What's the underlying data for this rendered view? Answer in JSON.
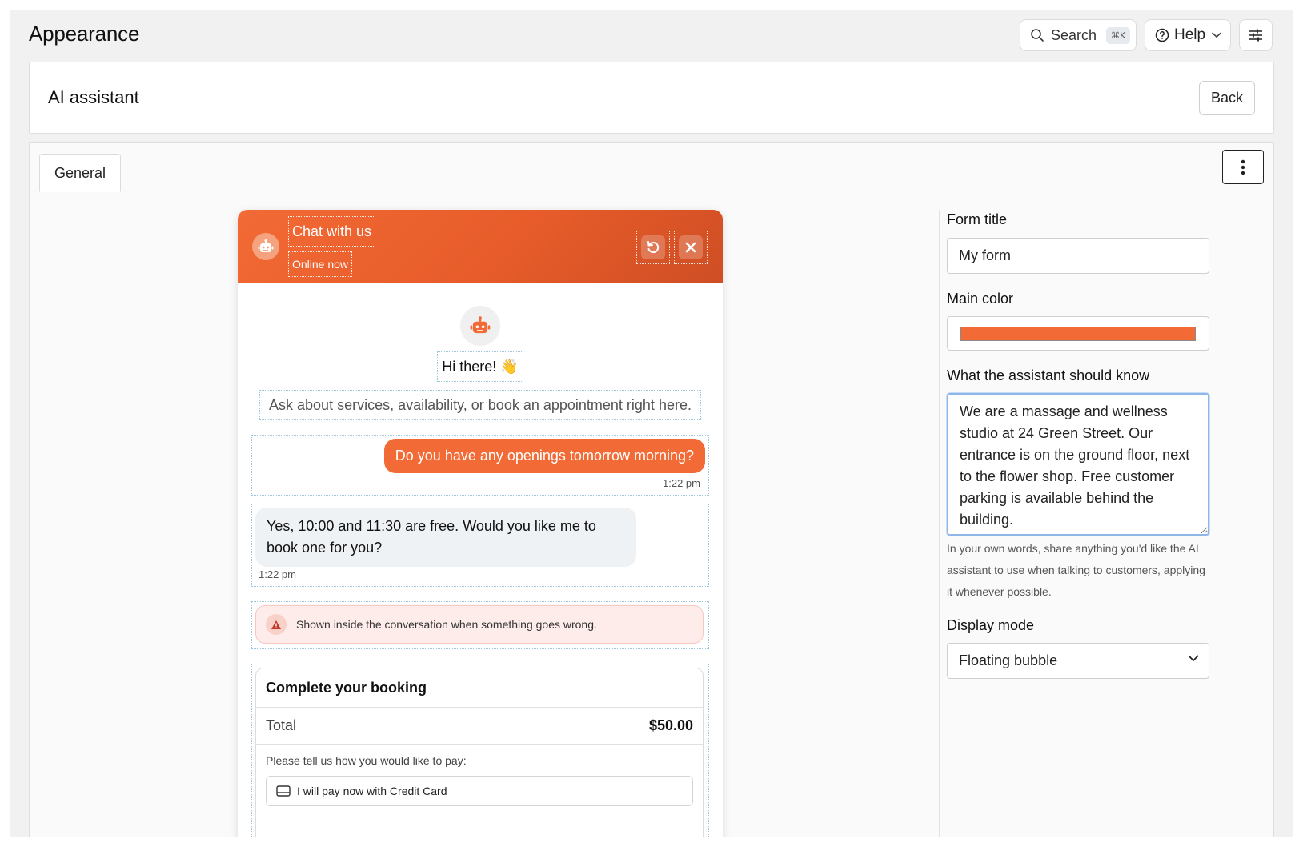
{
  "header": {
    "title": "Appearance",
    "search_label": "Search",
    "search_shortcut": "⌘K",
    "help_label": "Help"
  },
  "section": {
    "title": "AI assistant",
    "back_label": "Back"
  },
  "tabs": [
    {
      "label": "General",
      "active": true
    }
  ],
  "chat_preview": {
    "header_title": "Chat with us",
    "header_status": "Online now",
    "greeting": "Hi there! 👋",
    "subtitle": "Ask about services, availability, or book an appointment right here.",
    "messages": [
      {
        "from": "user",
        "text": "Do you have any openings tomorrow morning?",
        "time": "1:22 pm"
      },
      {
        "from": "bot",
        "text": "Yes, 10:00 and 11:30 are free. Would you like me to book one for you?",
        "time": "1:22 pm"
      }
    ],
    "error_text": "Shown inside the conversation when something goes wrong.",
    "booking": {
      "title": "Complete your booking",
      "total_label": "Total",
      "total_value": "$50.00",
      "payment_prompt": "Please tell us how you would like to pay:",
      "payment_option": "I will pay now with Credit Card"
    }
  },
  "form": {
    "form_title_label": "Form title",
    "form_title_value": "My form",
    "main_color_label": "Main color",
    "main_color_value": "#f26a35",
    "knowledge_label": "What the assistant should know",
    "knowledge_value": "We are a massage and wellness studio at 24 Green Street. Our entrance is on the ground floor, next to the flower shop. Free customer parking is available behind the building.",
    "knowledge_help": "In your own words, share anything you'd like the AI assistant to use when talking to customers, applying it whenever possible.",
    "display_mode_label": "Display mode",
    "display_mode_value": "Floating bubble"
  },
  "colors": {
    "accent": "#f26a35",
    "page_bg": "#f1f1f1",
    "bot_bubble": "#eff2f5",
    "error_bg": "#fdecea",
    "error_icon": "#c0392b"
  },
  "icons": [
    "search-icon",
    "help-circle-icon",
    "chevron-down-icon",
    "sliders-icon",
    "kebab-menu-icon",
    "robot-icon",
    "refresh-icon",
    "close-icon",
    "warning-icon",
    "credit-card-icon"
  ]
}
